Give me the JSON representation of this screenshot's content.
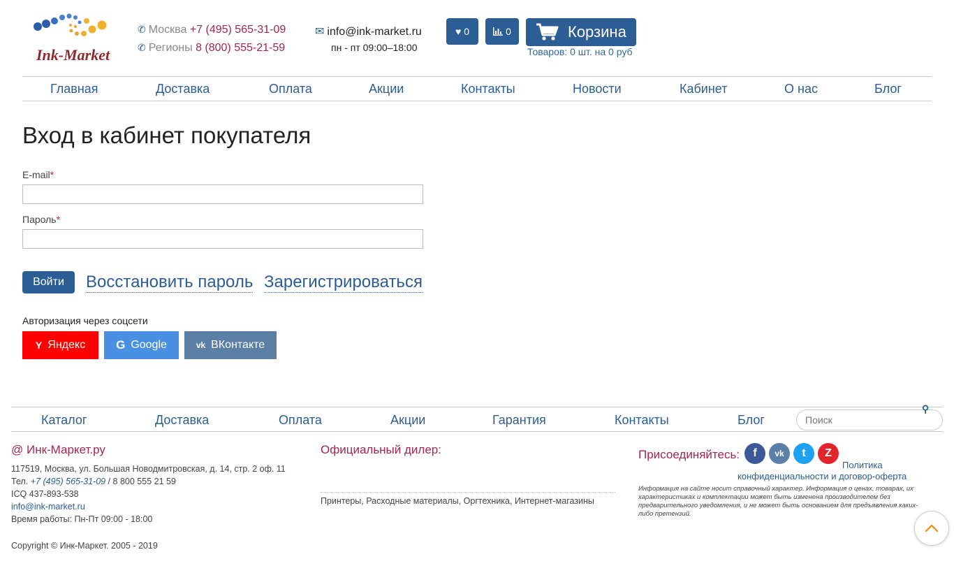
{
  "header": {
    "logo_text": "Ink-Market",
    "phones": [
      {
        "city": "Москва",
        "number": "+7 (495) 565-31-09"
      },
      {
        "city": "Регионы",
        "number": "8 (800) 555-21-59"
      }
    ],
    "email": "info@ink-market.ru",
    "hours": "пн - пт 09:00–18:00",
    "favorites_count": "0",
    "compare_count": "0",
    "cart_label": "Корзина",
    "cart_summary": "Товаров: 0 шт. на 0 руб"
  },
  "nav": {
    "items": [
      "Главная",
      "Доставка",
      "Оплата",
      "Акции",
      "Контакты",
      "Новости",
      "Кабинет",
      "О нас",
      "Блог"
    ]
  },
  "login": {
    "title": "Вход в кабинет покупателя",
    "email_label": "E-mail",
    "email_value": "",
    "password_label": "Пароль",
    "password_value": "",
    "required_mark": "*",
    "submit_label": "Войти",
    "restore_label": "Восстановить пароль",
    "register_label": "Зарегистрироваться",
    "social_caption": "Авторизация через соцсети",
    "social": [
      {
        "label": "Яндекс",
        "icon": "yandex-icon",
        "color": "#ff0000"
      },
      {
        "label": "Google",
        "icon": "google-icon",
        "color": "#4a90e2"
      },
      {
        "label": "ВКонтакте",
        "icon": "vk-icon",
        "color": "#5b7fa6"
      }
    ]
  },
  "footer": {
    "nav": [
      "Каталог",
      "Доставка",
      "Оплата",
      "Акции",
      "Гарантия",
      "Контакты",
      "Блог"
    ],
    "search_placeholder": "Поиск",
    "company": {
      "name": "@ Инк-Маркет.ру",
      "address": "117519, Москва, ул. Большая Новодмитровская, д. 14, стр. 2 оф. 11",
      "tel_label": "Тел.",
      "tel_main": "+7 (495) 565-31-09",
      "tel_sep": " / ",
      "tel_second": "8 800 555 21 59",
      "icq": "ICQ 437-893-538",
      "email": "info@ink-market.ru",
      "hours": "Время работы: Пн-Пт 09:00 - 18:00"
    },
    "dealer_title": "Официальный дилер:",
    "dealer_tags": "Принтеры, Расходные материалы, Оргтехника, Интернет-магазины",
    "join_label": "Присоединяйтесь:",
    "policy_line1": "Политика",
    "policy_line2": "конфиденциальности и договор-оферта",
    "disclaimer": "Информация на сайте носит справочный характер. Информация о ценах, товарах, их характеристиках и комплектации может быть изменена производителем без предварительного уведомления, и не может быть основанием для предъявления каких-либо претензий.",
    "copyright": "Copyright © Инк-Маркет. 2005 - 2019"
  },
  "colors": {
    "brand_blue": "#2c5d94",
    "accent_crimson": "#a2264f"
  }
}
